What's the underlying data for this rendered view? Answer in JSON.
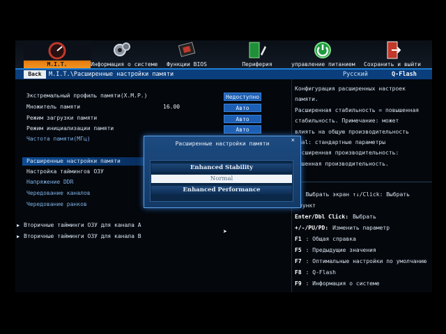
{
  "nav": {
    "items": [
      {
        "label": "M.I.T.",
        "icon": "speedometer-icon",
        "active": true
      },
      {
        "label": "Информация о системе",
        "icon": "gears-icon"
      },
      {
        "label": "Функции BIOS",
        "icon": "chip-icon"
      },
      {
        "label": "Периферия",
        "icon": "peripherals-icon"
      },
      {
        "label": "управление питанием",
        "icon": "power-icon"
      },
      {
        "label": "Сохранить и выйти",
        "icon": "exit-door-icon"
      }
    ]
  },
  "crumbbar": {
    "back": "Back",
    "path": "M.I.T.\\Расширенные настройки памяти",
    "language": "Русский",
    "qflash": "Q-Flash"
  },
  "settings": {
    "xmp": {
      "label": "Экстремальный профиль памяти(X.M.P.)",
      "value": "Недоступно"
    },
    "multiplier": {
      "label": "Множитель памяти",
      "value": "16.00",
      "button": "Авто"
    },
    "boot_mode": {
      "label": "Режим загрузки памяти",
      "value": "Авто"
    },
    "init_mode": {
      "label": "Режим инициализации памяти",
      "value": "Авто"
    },
    "frequency": {
      "label": "Частота памяти(МГц)"
    },
    "advanced": {
      "label": "Расширенные настройки памяти",
      "value": "Normal"
    },
    "timings": {
      "label": "Настройка таймингов ОЗУ"
    },
    "ddr_voltage": {
      "label": "Напряжение DDR"
    },
    "channel_interleave": {
      "label": "Чередование каналов"
    },
    "rank_interleave": {
      "label": "Чередование ранков"
    },
    "secondary_a": {
      "label": "Вторичные тайминги ОЗУ для канала A"
    },
    "secondary_b": {
      "label": "Вторичные тайминги ОЗУ для канала B"
    }
  },
  "help": {
    "description": [
      "Конфигурация расширенных настроек",
      "памяти.",
      "Расширенная стабильность = повышенная",
      "стабильность. Примечание: может",
      "влиять на общую производительность",
      "rmal: стандартные параметры",
      "расширенная производительность:",
      "вышенная производительность."
    ],
    "keys": [
      {
        "key": "",
        "text": ": Выбрать экран  ↑↓/Click: Выбрать"
      },
      {
        "key": "",
        "text": "пункт"
      },
      {
        "key": "Enter/Dbl Click:",
        "text": "Выбрать"
      },
      {
        "key": "+/-/PU/PD:",
        "text": "Изменить параметр"
      },
      {
        "key": "F1",
        "text": ": Общая справка"
      },
      {
        "key": "F5",
        "text": ": Предыдущие значения"
      },
      {
        "key": "F7",
        "text": ": Оптимальные настройки по умолчанию"
      },
      {
        "key": "F8",
        "text": ": Q-Flash"
      },
      {
        "key": "F9",
        "text": ": Информация о системе"
      }
    ]
  },
  "modal": {
    "title": "Расширенные настройки памяти",
    "close": "×",
    "options": [
      "Enhanced Stability",
      "Normal",
      "Enhanced Performance"
    ],
    "selected": "Normal"
  }
}
